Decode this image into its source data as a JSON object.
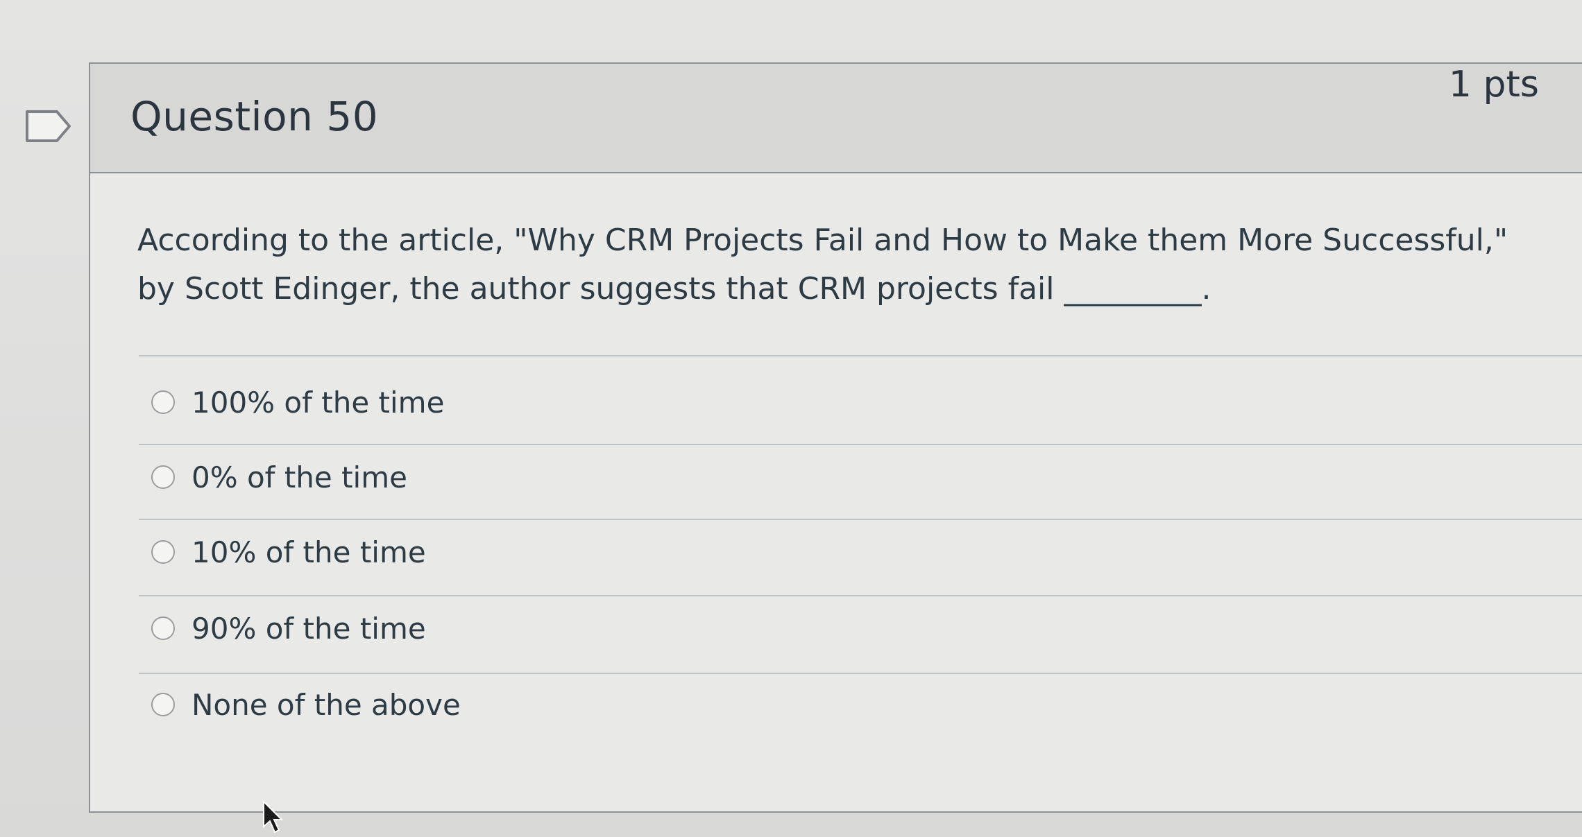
{
  "question": {
    "title": "Question 50",
    "points": "1 pts",
    "text": "According to the article, \"Why CRM Projects Fail and How to Make them More Successful,\" by Scott Edinger, the author suggests that CRM projects fail _________.",
    "answers": [
      {
        "label": "100% of the time"
      },
      {
        "label": "0% of the time"
      },
      {
        "label": "10% of the time"
      },
      {
        "label": "90% of the time"
      },
      {
        "label": "None of the above"
      }
    ]
  },
  "icons": {
    "flag": "flag-question-icon",
    "radio": "radio-button-icon",
    "cursor": "mouse-pointer-icon"
  },
  "colors": {
    "text": "#2d3b45",
    "header_bg": "#d7d7d6",
    "card_bg": "#e9e9e8",
    "border": "#8e9194"
  }
}
